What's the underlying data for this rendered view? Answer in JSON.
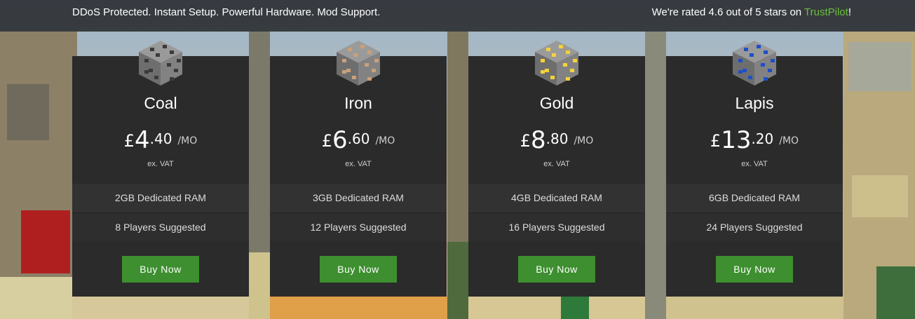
{
  "topbar": {
    "tagline": "DDoS Protected. Instant Setup. Powerful Hardware. Mod Support.",
    "rating_prefix": "We're rated 4.6 out of 5 stars on ",
    "rating_link": "TrustPilot",
    "rating_suffix": "!"
  },
  "plans": [
    {
      "name": "Coal",
      "currency": "£",
      "whole": "4",
      "cents": ".40",
      "per": "/MO",
      "vat": "ex. VAT",
      "ram": "2GB Dedicated RAM",
      "players": "8 Players Suggested",
      "button": "Buy Now",
      "icon": "coal-ore-icon",
      "ore_color": "#3a3a3a"
    },
    {
      "name": "Iron",
      "currency": "£",
      "whole": "6",
      "cents": ".60",
      "per": "/MO",
      "vat": "ex. VAT",
      "ram": "3GB Dedicated RAM",
      "players": "12 Players Suggested",
      "button": "Buy Now",
      "icon": "iron-ore-icon",
      "ore_color": "#c9a07a"
    },
    {
      "name": "Gold",
      "currency": "£",
      "whole": "8",
      "cents": ".80",
      "per": "/MO",
      "vat": "ex. VAT",
      "ram": "4GB Dedicated RAM",
      "players": "16 Players Suggested",
      "button": "Buy Now",
      "icon": "gold-ore-icon",
      "ore_color": "#f2d23a"
    },
    {
      "name": "Lapis",
      "currency": "£",
      "whole": "13",
      "cents": ".20",
      "per": "/MO",
      "vat": "ex. VAT",
      "ram": "6GB Dedicated RAM",
      "players": "24 Players Suggested",
      "button": "Buy Now",
      "icon": "lapis-ore-icon",
      "ore_color": "#1f4fc8"
    }
  ],
  "colors": {
    "accent": "#3d8f2f",
    "link": "#6bbf3a",
    "card_bg": "#2b2b2b"
  }
}
